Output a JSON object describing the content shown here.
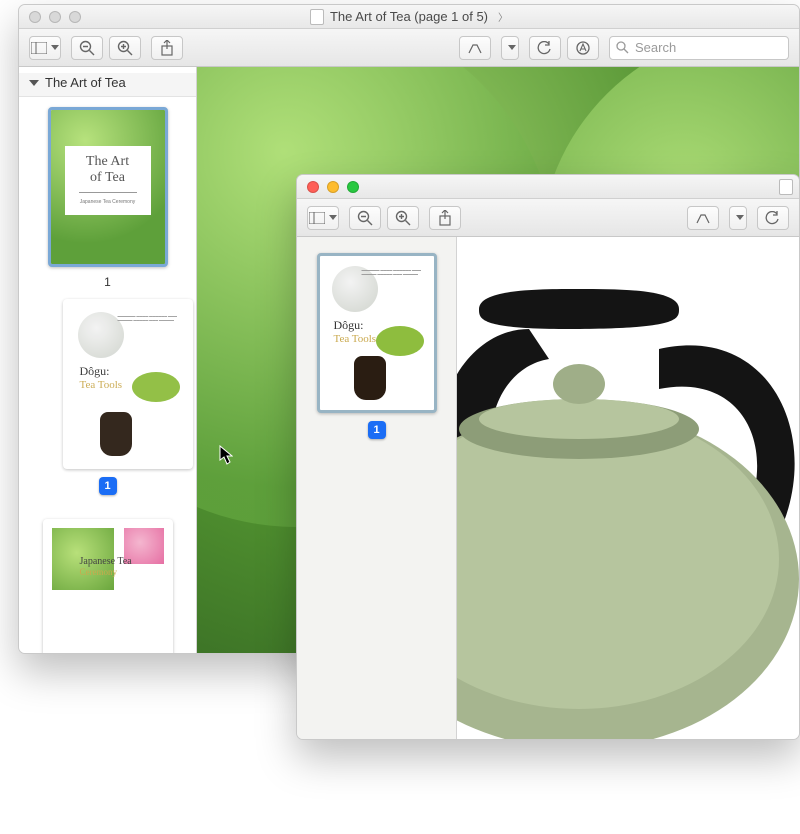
{
  "window1": {
    "title": "The Art of Tea (page 1 of 5)",
    "sidebar_header": "The Art of Tea",
    "search_placeholder": "Search",
    "pages": {
      "1": {
        "label": "1",
        "cover_title_1": "The Art",
        "cover_title_2": "of Tea",
        "cover_sub": "Japanese Tea Ceremony"
      },
      "2": {
        "badge": "1",
        "heading": "Dôgu:",
        "subheading": "Tea Tools"
      },
      "3": {
        "heading": "Japanese Tea",
        "subheading": "Ceremony"
      }
    }
  },
  "window2": {
    "pages": {
      "1": {
        "badge": "1",
        "heading": "Dôgu:",
        "subheading": "Tea Tools"
      }
    }
  }
}
